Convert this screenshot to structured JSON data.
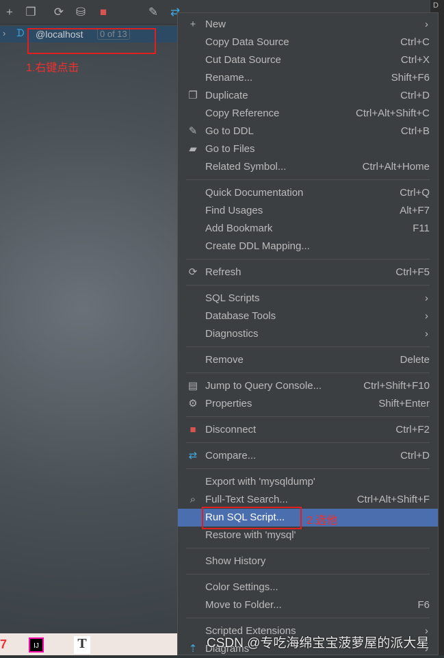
{
  "toolbar": {
    "icons": [
      "add-icon",
      "copy-icon",
      "refresh-icon",
      "db-tools-icon",
      "stop-icon",
      "edit-icon",
      "compare-icon"
    ]
  },
  "tree": {
    "expand": "›",
    "name": "@localhost",
    "badge": "0 of 13"
  },
  "annotations": {
    "step1": "1.右键点击",
    "step2": "2.选他"
  },
  "right_panel": "D",
  "menu": [
    {
      "label": "New",
      "icon": "+",
      "submenu": true
    },
    {
      "label": "Copy Data Source",
      "shortcut": "Ctrl+C"
    },
    {
      "label": "Cut Data Source",
      "shortcut": "Ctrl+X"
    },
    {
      "label": "Rename...",
      "shortcut": "Shift+F6"
    },
    {
      "label": "Duplicate",
      "icon": "❐",
      "shortcut": "Ctrl+D"
    },
    {
      "label": "Copy Reference",
      "shortcut": "Ctrl+Alt+Shift+C"
    },
    {
      "label": "Go to DDL",
      "icon": "✎",
      "shortcut": "Ctrl+B"
    },
    {
      "label": "Go to Files",
      "icon": "▰"
    },
    {
      "label": "Related Symbol...",
      "shortcut": "Ctrl+Alt+Home"
    },
    {
      "sep": true
    },
    {
      "label": "Quick Documentation",
      "shortcut": "Ctrl+Q"
    },
    {
      "label": "Find Usages",
      "shortcut": "Alt+F7"
    },
    {
      "label": "Add Bookmark",
      "shortcut": "F11"
    },
    {
      "label": "Create DDL Mapping..."
    },
    {
      "sep": true
    },
    {
      "label": "Refresh",
      "icon": "⟳",
      "shortcut": "Ctrl+F5"
    },
    {
      "sep": true
    },
    {
      "label": "SQL Scripts",
      "submenu": true
    },
    {
      "label": "Database Tools",
      "submenu": true
    },
    {
      "label": "Diagnostics",
      "submenu": true
    },
    {
      "sep": true
    },
    {
      "label": "Remove",
      "shortcut": "Delete"
    },
    {
      "sep": true
    },
    {
      "label": "Jump to Query Console...",
      "icon": "▤",
      "shortcut": "Ctrl+Shift+F10"
    },
    {
      "label": "Properties",
      "icon": "⚙",
      "shortcut": "Shift+Enter"
    },
    {
      "sep": true
    },
    {
      "label": "Disconnect",
      "icon": "■",
      "iconColor": "#d9534f",
      "shortcut": "Ctrl+F2"
    },
    {
      "sep": true
    },
    {
      "label": "Compare...",
      "icon": "⇄",
      "iconColor": "#3fa7e0",
      "shortcut": "Ctrl+D"
    },
    {
      "sep": true
    },
    {
      "label": "Export with 'mysqldump'"
    },
    {
      "label": "Full-Text Search...",
      "icon": "⌕",
      "shortcut": "Ctrl+Alt+Shift+F"
    },
    {
      "label": "Run SQL Script...",
      "selected": true
    },
    {
      "label": "Restore with 'mysql'"
    },
    {
      "sep": true
    },
    {
      "label": "Show History"
    },
    {
      "sep": true
    },
    {
      "label": "Color Settings..."
    },
    {
      "label": "Move to Folder...",
      "shortcut": "F6"
    },
    {
      "sep": true
    },
    {
      "label": "Scripted Extensions",
      "submenu": true
    },
    {
      "label": "Diagrams",
      "icon": "⇡",
      "iconColor": "#3fa7e0",
      "submenu": true
    }
  ],
  "watermark": "CSDN @专吃海绵宝宝菠萝屋的派大星",
  "colors": {
    "selection": "#4b6eaf",
    "annotation": "#e02020"
  }
}
